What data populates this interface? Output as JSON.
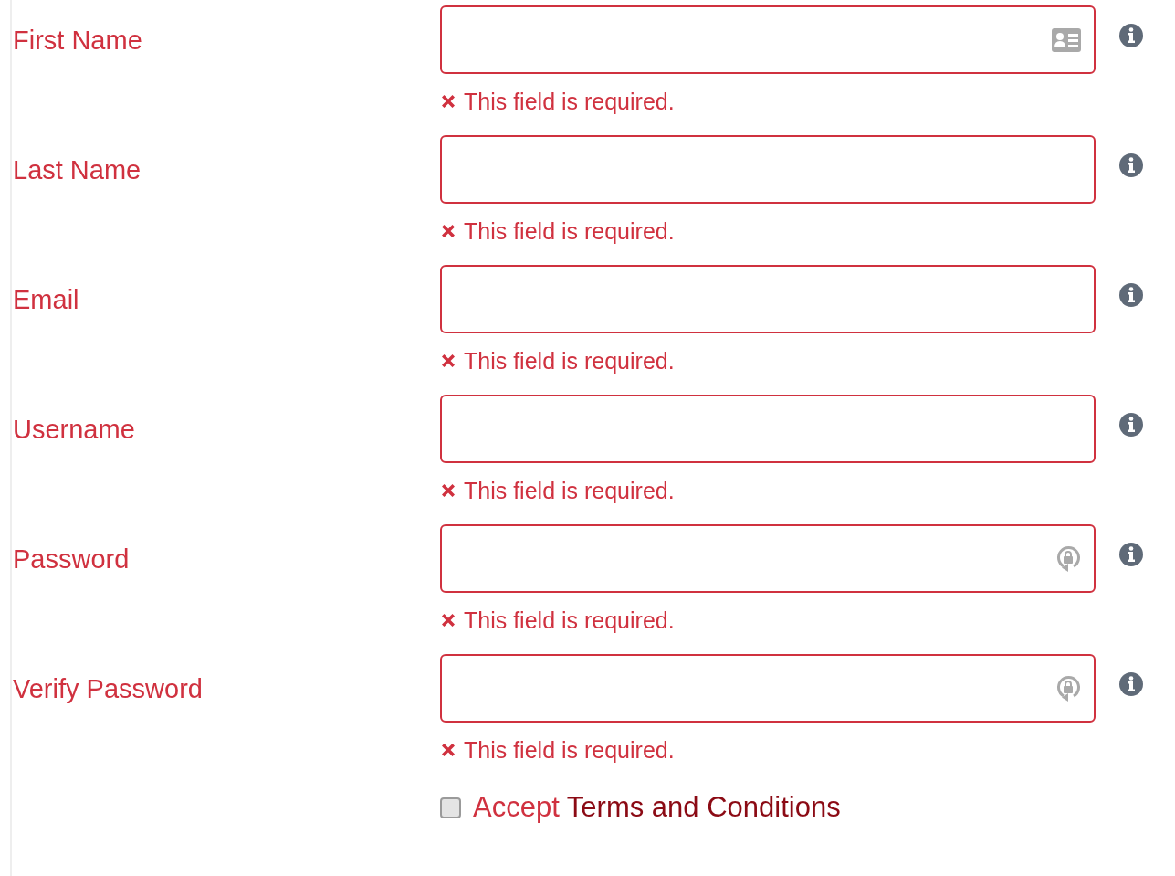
{
  "fields": [
    {
      "kind": "card",
      "label": "First Name",
      "error": "This field is required."
    },
    {
      "kind": "plain",
      "label": "Last Name",
      "error": "This field is required."
    },
    {
      "kind": "plain",
      "label": "Email",
      "error": "This field is required."
    },
    {
      "kind": "plain",
      "label": "Username",
      "error": "This field is required."
    },
    {
      "kind": "lock",
      "label": "Password",
      "error": "This field is required."
    },
    {
      "kind": "lock",
      "label": "Verify Password",
      "error": "This field is required."
    }
  ],
  "terms": {
    "checked": false,
    "label": "Accept",
    "link": "Terms and Conditions"
  }
}
